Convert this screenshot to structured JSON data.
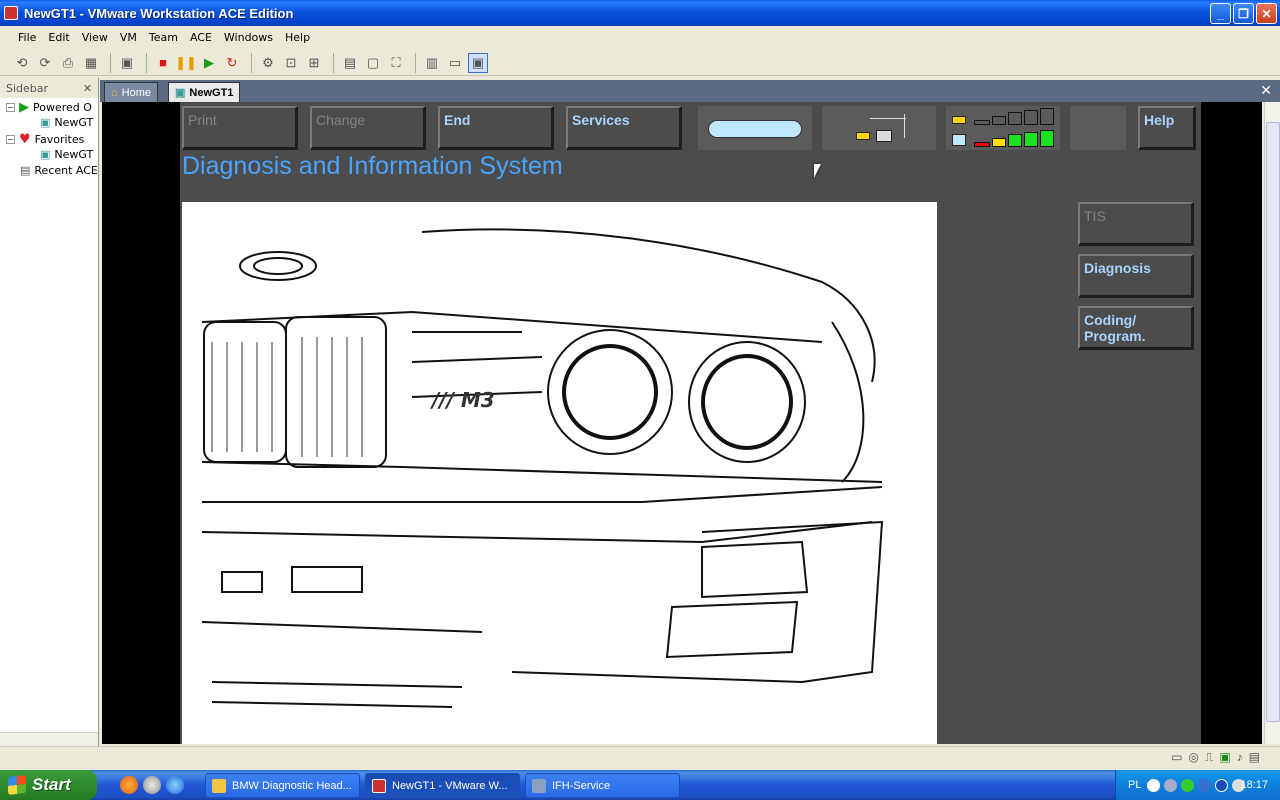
{
  "window": {
    "title": "NewGT1 - VMware Workstation ACE Edition",
    "btn_min": "_",
    "btn_max": "❐",
    "btn_close": "✕"
  },
  "menu": [
    "File",
    "Edit",
    "View",
    "VM",
    "Team",
    "ACE",
    "Windows",
    "Help"
  ],
  "sidebar": {
    "title": "Sidebar",
    "close": "✕",
    "items": [
      {
        "label": "Powered O",
        "icon": "play-icon"
      },
      {
        "label": "NewGT",
        "icon": "vm-icon"
      },
      {
        "label": "Favorites",
        "icon": "heart-icon"
      },
      {
        "label": "NewGT",
        "icon": "vm-icon"
      },
      {
        "label": "Recent ACE",
        "icon": "recent-icon"
      }
    ],
    "expander": "⊟"
  },
  "tabs": [
    {
      "label": "Home",
      "icon": "home-icon"
    },
    {
      "label": "NewGT1",
      "icon": "vm-icon"
    }
  ],
  "tab_close": "✕",
  "dis": {
    "title": "Diagnosis and Information System",
    "top_buttons": [
      {
        "label": "Print",
        "state": "disabled"
      },
      {
        "label": "Change",
        "state": "disabled"
      },
      {
        "label": "End",
        "state": "enabled"
      },
      {
        "label": "Services",
        "state": "enabled"
      },
      {
        "label": "Help",
        "state": "enabled"
      }
    ],
    "side_buttons": [
      {
        "label": "TIS",
        "state": "disabled"
      },
      {
        "label": "Diagnosis",
        "state": "enabled"
      },
      {
        "label": "Coding/ Program.",
        "state": "enabled"
      }
    ],
    "colors": {
      "bg": "#4c4c4c",
      "title": "#4aa4ff",
      "button_text": "#a9d3ff",
      "disabled_text": "#838383"
    }
  },
  "taskbar": {
    "start": "Start",
    "tasks": [
      {
        "label": "BMW Diagnostic Head...",
        "active": false
      },
      {
        "label": "NewGT1 - VMware W...",
        "active": true
      },
      {
        "label": "IFH-Service",
        "active": false
      }
    ],
    "lang": "PL",
    "clock": "18:17"
  }
}
